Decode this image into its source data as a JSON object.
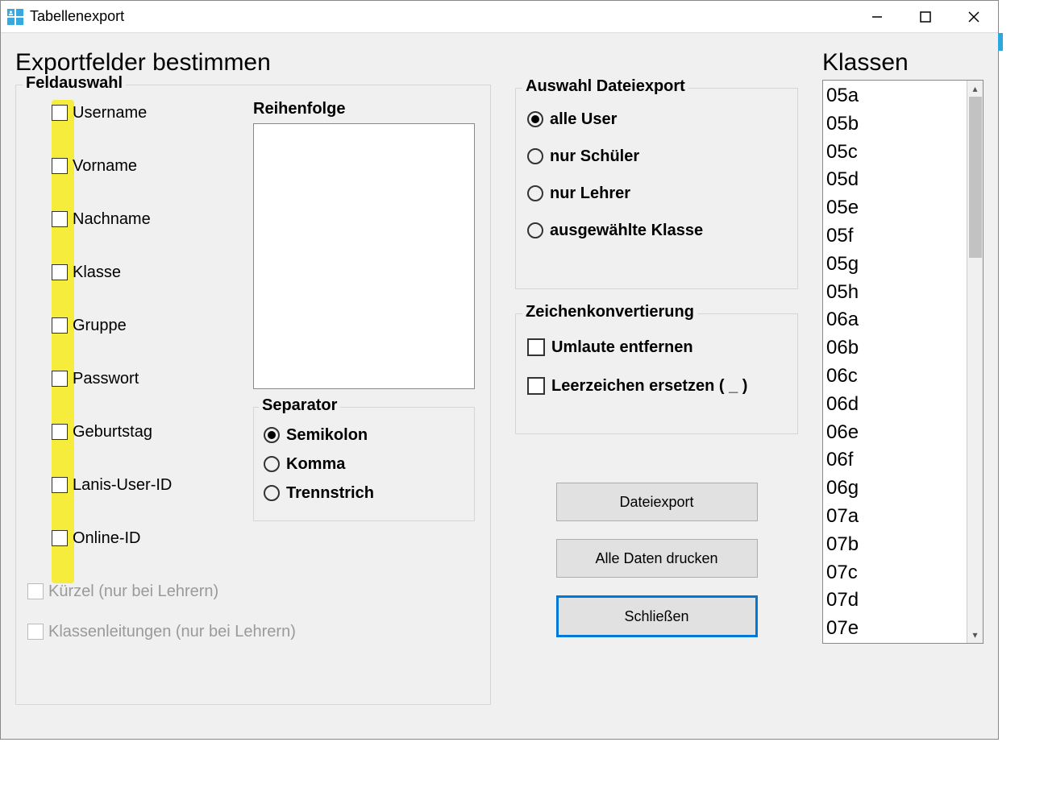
{
  "window": {
    "title": "Tabellenexport"
  },
  "heading": "Exportfelder bestimmen",
  "feldauswahl": {
    "legend": "Feldauswahl",
    "fields": [
      {
        "label": "Username",
        "disabled": false
      },
      {
        "label": "Vorname",
        "disabled": false
      },
      {
        "label": "Nachname",
        "disabled": false
      },
      {
        "label": "Klasse",
        "disabled": false
      },
      {
        "label": "Gruppe",
        "disabled": false
      },
      {
        "label": "Passwort",
        "disabled": false
      },
      {
        "label": "Geburtstag",
        "disabled": false
      },
      {
        "label": "Lanis-User-ID",
        "disabled": false
      },
      {
        "label": "Online-ID",
        "disabled": false
      }
    ],
    "disabled_fields": [
      {
        "label": "Kürzel (nur bei Lehrern)"
      },
      {
        "label": "Klassenleitungen (nur bei Lehrern)"
      }
    ],
    "order_label": "Reihenfolge",
    "separator": {
      "legend": "Separator",
      "options": [
        {
          "label": "Semikolon",
          "checked": true
        },
        {
          "label": "Komma",
          "checked": false
        },
        {
          "label": "Trennstrich",
          "checked": false
        }
      ]
    }
  },
  "export_selection": {
    "legend": "Auswahl Dateiexport",
    "options": [
      {
        "label": "alle User",
        "checked": true
      },
      {
        "label": "nur Schüler",
        "checked": false
      },
      {
        "label": "nur Lehrer",
        "checked": false
      },
      {
        "label": "ausgewählte Klasse",
        "checked": false
      }
    ]
  },
  "char_conversion": {
    "legend": "Zeichenkonvertierung",
    "options": [
      {
        "label": "Umlaute entfernen"
      },
      {
        "label": "Leerzeichen ersetzen ( _ )"
      }
    ]
  },
  "buttons": {
    "export": "Dateiexport",
    "print": "Alle Daten drucken",
    "close": "Schließen"
  },
  "klassen": {
    "title": "Klassen",
    "items": [
      "05a",
      "05b",
      "05c",
      "05d",
      "05e",
      "05f",
      "05g",
      "05h",
      "06a",
      "06b",
      "06c",
      "06d",
      "06e",
      "06f",
      "06g",
      "07a",
      "07b",
      "07c",
      "07d",
      "07e"
    ]
  }
}
